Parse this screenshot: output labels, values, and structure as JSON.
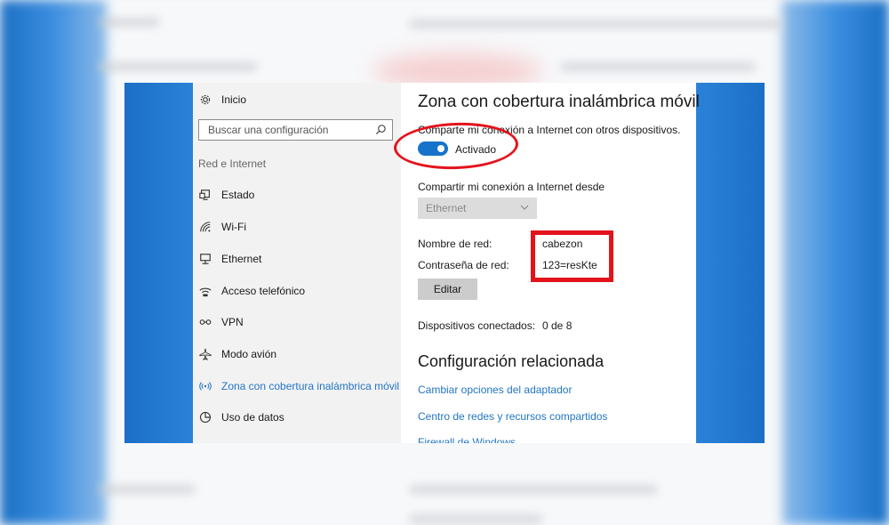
{
  "sidebar": {
    "home_label": "Inicio",
    "search_placeholder": "Buscar una configuración",
    "section_label": "Red e Internet",
    "items": [
      {
        "label": "Estado",
        "icon": "status-icon"
      },
      {
        "label": "Wi-Fi",
        "icon": "wifi-icon"
      },
      {
        "label": "Ethernet",
        "icon": "ethernet-icon"
      },
      {
        "label": "Acceso telefónico",
        "icon": "dialup-icon"
      },
      {
        "label": "VPN",
        "icon": "vpn-icon"
      },
      {
        "label": "Modo avión",
        "icon": "airplane-icon"
      },
      {
        "label": "Zona con cobertura inalámbrica móvil",
        "icon": "hotspot-icon",
        "active": true
      },
      {
        "label": "Uso de datos",
        "icon": "data-usage-icon"
      }
    ]
  },
  "content": {
    "title": "Zona con cobertura inalámbrica móvil",
    "share_description": "Comparte mi conexión a Internet con otros dispositivos.",
    "toggle": {
      "state": "on",
      "label": "Activado"
    },
    "share_from_label": "Compartir mi conexión a Internet desde",
    "share_from_value": "Ethernet",
    "network_name_label": "Nombre de red:",
    "network_name_value": "cabezon",
    "password_label": "Contraseña de red:",
    "password_value": "123=resKte",
    "edit_button": "Editar",
    "connected_label": "Dispositivos conectados:",
    "connected_value": "0 de 8",
    "related_title": "Configuración relacionada",
    "related_links": [
      "Cambiar opciones del adaptador",
      "Centro de redes y recursos compartidos",
      "Firewall de Windows"
    ]
  },
  "colors": {
    "accent": "#1673c9",
    "link": "#2276c4",
    "annotation": "#e3131c",
    "sidebar_bg": "#f2f2f2"
  }
}
